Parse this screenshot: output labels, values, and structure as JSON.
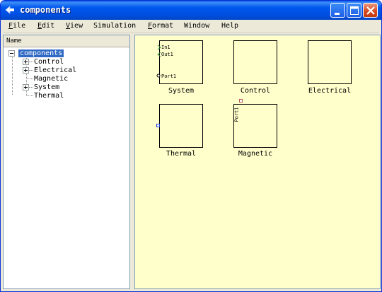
{
  "window": {
    "title": "components"
  },
  "menu": [
    {
      "label": "File",
      "underline": "F",
      "rest": "ile"
    },
    {
      "label": "Edit",
      "underline": "E",
      "rest": "dit"
    },
    {
      "label": "View",
      "underline": "V",
      "rest": "iew"
    },
    {
      "label": "Simulation",
      "underline": "",
      "rest": "Simulation"
    },
    {
      "label": "Format",
      "underline": "F",
      "rest": "ormat"
    },
    {
      "label": "Window",
      "underline": "",
      "rest": "Window"
    },
    {
      "label": "Help",
      "underline": "",
      "rest": "Help"
    }
  ],
  "tree": {
    "header": "Name",
    "root": "components",
    "children": [
      {
        "label": "Control",
        "expandable": true
      },
      {
        "label": "Electrical",
        "expandable": true
      },
      {
        "label": "Magnetic",
        "expandable": false
      },
      {
        "label": "System",
        "expandable": true
      },
      {
        "label": "Thermal",
        "expandable": false
      }
    ]
  },
  "blocks": [
    {
      "name": "System",
      "ports": [
        "In1",
        "Out1",
        "Port1"
      ]
    },
    {
      "name": "Control",
      "ports": []
    },
    {
      "name": "Electrical",
      "ports": []
    },
    {
      "name": "Thermal",
      "ports": []
    },
    {
      "name": "Magnetic",
      "ports": [
        "Port1"
      ]
    }
  ],
  "colors": {
    "canvas": "#ffffcc",
    "title_bar": "#0058ee",
    "selection": "#316ac5",
    "input_port": "#2e8b2e",
    "connection_port": "#1e3fd0"
  }
}
